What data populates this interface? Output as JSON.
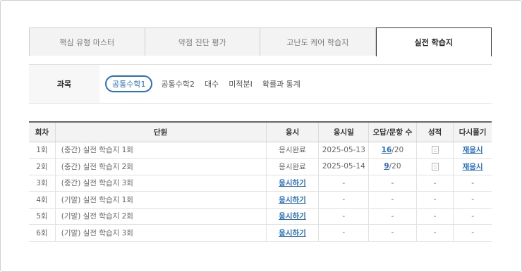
{
  "tabs": [
    {
      "label": "핵심 유형 마스터"
    },
    {
      "label": "약점 진단 평가"
    },
    {
      "label": "고난도 케어 학습지"
    },
    {
      "label": "실전 학습지"
    }
  ],
  "active_tab_index": 3,
  "subject": {
    "label": "과목",
    "options": [
      "공통수학1",
      "공통수학2",
      "대수",
      "미적분Ⅰ",
      "확률과 통계"
    ],
    "selected": "공통수학1"
  },
  "table": {
    "headers": [
      "회차",
      "단원",
      "응시",
      "응시일",
      "오답/문항 수",
      "성적",
      "다시풀기"
    ],
    "rows": [
      {
        "round": "1회",
        "unit": "(중간) 실전 학습지 1회",
        "status": "응시완료",
        "date": "2025-05-13",
        "wrong": "16",
        "total": "/20",
        "score_icon": "report-icon",
        "retry": "재응시"
      },
      {
        "round": "2회",
        "unit": "(중간) 실전 학습지 2회",
        "status": "응시완료",
        "date": "2025-05-14",
        "wrong": "9",
        "total": "/20",
        "score_icon": "report-icon",
        "retry": "재응시"
      },
      {
        "round": "3회",
        "unit": "(중간) 실전 학습지 3회",
        "status": "응시하기",
        "date": "-",
        "wrong": "-",
        "total": "",
        "score": "-",
        "retry": "-"
      },
      {
        "round": "4회",
        "unit": "(기말) 실전 학습지 1회",
        "status": "응시하기",
        "date": "-",
        "wrong": "-",
        "total": "",
        "score": "-",
        "retry": "-"
      },
      {
        "round": "5회",
        "unit": "(기말) 실전 학습지 2회",
        "status": "응시하기",
        "date": "-",
        "wrong": "-",
        "total": "",
        "score": "-",
        "retry": "-"
      },
      {
        "round": "6회",
        "unit": "(기말) 실전 학습지 3회",
        "status": "응시하기",
        "date": "-",
        "wrong": "-",
        "total": "",
        "score": "-",
        "retry": "-"
      }
    ]
  },
  "colors": {
    "accent": "#2a6fc2",
    "header_bg": "#f3f3f3"
  }
}
